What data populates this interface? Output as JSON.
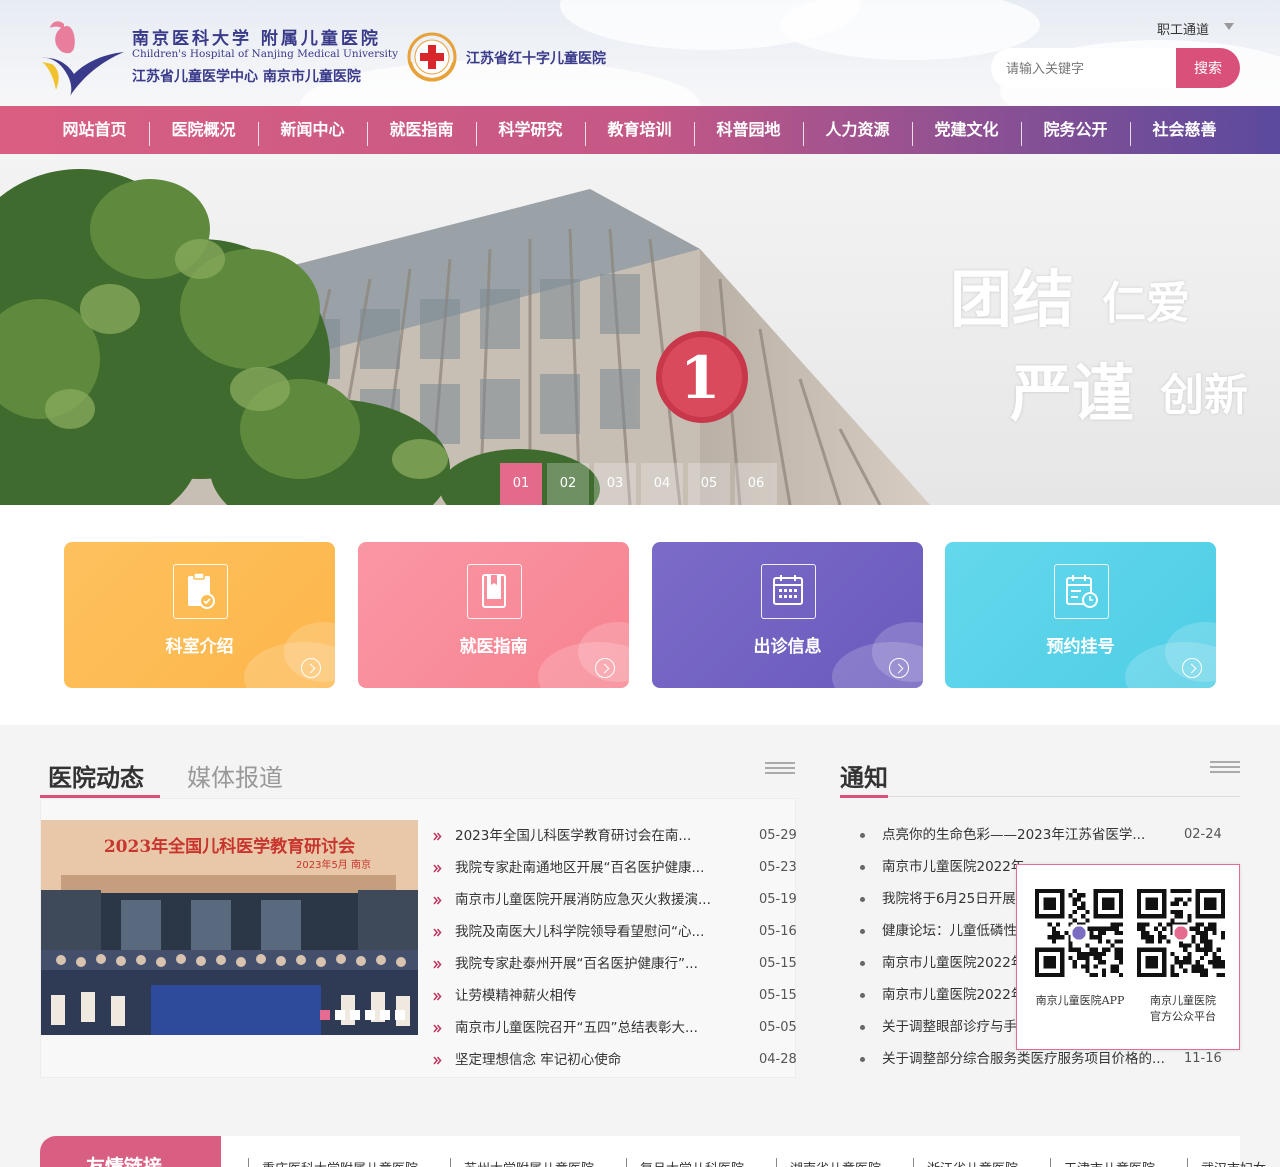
{
  "header": {
    "logo_cn": "南京医科大学 附属儿童医院",
    "logo_en": "Children's Hospital of Nanjing Medical University",
    "logo_sub": "江苏省儿童医学中心  南京市儿童医院",
    "redcross_name": "江苏省红十字儿童医院",
    "staff_channel": "职工通道",
    "search_placeholder": "请输入关键字",
    "search_button": "搜索",
    "colors": {
      "brand_purple": "#3a3a8a",
      "accent_pink": "#d9507a"
    }
  },
  "nav": [
    "网站首页",
    "医院概况",
    "新闻中心",
    "就医指南",
    "科学研究",
    "教育培训",
    "科普园地",
    "人力资源",
    "党建文化",
    "院务公开",
    "社会慈善"
  ],
  "banner": {
    "slogan_line1a": "团结",
    "slogan_line1b": "仁爱",
    "slogan_line2a": "严谨",
    "slogan_line2b": "创新",
    "building_sign": "1",
    "dots": [
      "01",
      "02",
      "03",
      "04",
      "05",
      "06"
    ],
    "active_dot": 0
  },
  "cards": [
    {
      "label": "科室介绍",
      "icon": "clipboard-check-icon",
      "color": "#fdbd55"
    },
    {
      "label": "就医指南",
      "icon": "book-icon",
      "color": "#f98d9d"
    },
    {
      "label": "出诊信息",
      "icon": "calendar-icon",
      "color": "#7565c4"
    },
    {
      "label": "预约挂号",
      "icon": "calendar-clock-icon",
      "color": "#5bd3e9"
    }
  ],
  "news": {
    "tab_active": "医院动态",
    "tab_inactive": "媒体报道",
    "image_headline": "2023年全国儿科医学教育研讨会",
    "image_subline": "2023年5月 南京",
    "slide_count": 6,
    "items": [
      {
        "title": "2023年全国儿科医学教育研讨会在南...",
        "date": "05-29"
      },
      {
        "title": "我院专家赴南通地区开展“百名医护健康...",
        "date": "05-23"
      },
      {
        "title": "南京市儿童医院开展消防应急灭火救援演...",
        "date": "05-19"
      },
      {
        "title": "我院及南医大儿科学院领导看望慰问“心...",
        "date": "05-16"
      },
      {
        "title": "我院专家赴泰州开展“百名医护健康行”...",
        "date": "05-15"
      },
      {
        "title": "让劳模精神薪火相传",
        "date": "05-15"
      },
      {
        "title": "南京市儿童医院召开“五四”总结表彰大...",
        "date": "05-05"
      },
      {
        "title": "坚定理想信念 牢记初心使命",
        "date": "04-28"
      }
    ]
  },
  "notice": {
    "title": "通知",
    "items": [
      {
        "title": "点亮你的生命色彩——2023年江苏省医学...",
        "date": "02-24"
      },
      {
        "title": "南京市儿童医院2022年",
        "date": ""
      },
      {
        "title": "我院将于6月25日开展",
        "date": ""
      },
      {
        "title": "健康论坛：儿童低磷性",
        "date": ""
      },
      {
        "title": "南京市儿童医院2022年",
        "date": ""
      },
      {
        "title": "南京市儿童医院2022年",
        "date": ""
      },
      {
        "title": "关于调整眼部诊疗与手",
        "date": ""
      },
      {
        "title": "关于调整部分综合服务类医疗服务项目价格的...",
        "date": "11-16"
      }
    ]
  },
  "qr": {
    "app_label": "南京儿童医院APP",
    "wechat_label1": "南京儿童医院",
    "wechat_label2": "官方公众平台"
  },
  "links": {
    "title": "友情链接",
    "items": [
      "重庆医科大学附属儿童医院",
      "苏州大学附属儿童医院",
      "复旦大学儿科医院",
      "湖南省儿童医院",
      "浙江省儿童医院",
      "天津市儿童医院",
      "武汉市妇女"
    ]
  }
}
